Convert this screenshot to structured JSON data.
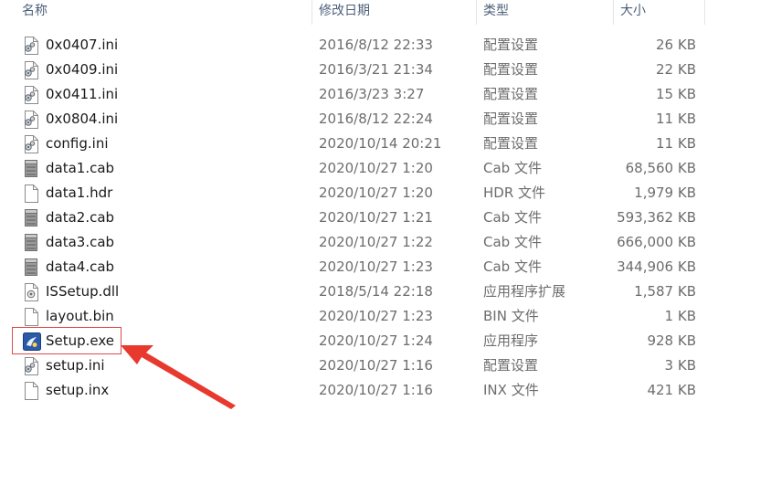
{
  "columns": {
    "name": "名称",
    "date": "修改日期",
    "type": "类型",
    "size": "大小"
  },
  "files": [
    {
      "name": "0x0407.ini",
      "date": "2016/8/12 22:33",
      "type": "配置设置",
      "size": "26 KB",
      "icon": "ini-settings-icon"
    },
    {
      "name": "0x0409.ini",
      "date": "2016/3/21 21:34",
      "type": "配置设置",
      "size": "22 KB",
      "icon": "ini-settings-icon"
    },
    {
      "name": "0x0411.ini",
      "date": "2016/3/23 3:27",
      "type": "配置设置",
      "size": "15 KB",
      "icon": "ini-settings-icon"
    },
    {
      "name": "0x0804.ini",
      "date": "2016/8/12 22:24",
      "type": "配置设置",
      "size": "11 KB",
      "icon": "ini-settings-icon"
    },
    {
      "name": "config.ini",
      "date": "2020/10/14 20:21",
      "type": "配置设置",
      "size": "11 KB",
      "icon": "ini-settings-icon"
    },
    {
      "name": "data1.cab",
      "date": "2020/10/27 1:20",
      "type": "Cab 文件",
      "size": "68,560 KB",
      "icon": "cab-archive-icon"
    },
    {
      "name": "data1.hdr",
      "date": "2020/10/27 1:20",
      "type": "HDR 文件",
      "size": "1,979 KB",
      "icon": "blank-file-icon"
    },
    {
      "name": "data2.cab",
      "date": "2020/10/27 1:21",
      "type": "Cab 文件",
      "size": "593,362 KB",
      "icon": "cab-archive-icon"
    },
    {
      "name": "data3.cab",
      "date": "2020/10/27 1:22",
      "type": "Cab 文件",
      "size": "666,000 KB",
      "icon": "cab-archive-icon"
    },
    {
      "name": "data4.cab",
      "date": "2020/10/27 1:23",
      "type": "Cab 文件",
      "size": "344,906 KB",
      "icon": "cab-archive-icon"
    },
    {
      "name": "ISSetup.dll",
      "date": "2018/5/14 22:18",
      "type": "应用程序扩展",
      "size": "1,587 KB",
      "icon": "dll-gear-icon"
    },
    {
      "name": "layout.bin",
      "date": "2020/10/27 1:23",
      "type": "BIN 文件",
      "size": "1 KB",
      "icon": "blank-file-icon"
    },
    {
      "name": "Setup.exe",
      "date": "2020/10/27 1:24",
      "type": "应用程序",
      "size": "928 KB",
      "icon": "setup-exe-icon"
    },
    {
      "name": "setup.ini",
      "date": "2020/10/27 1:16",
      "type": "配置设置",
      "size": "3 KB",
      "icon": "ini-settings-icon"
    },
    {
      "name": "setup.inx",
      "date": "2020/10/27 1:16",
      "type": "INX 文件",
      "size": "421 KB",
      "icon": "blank-file-icon"
    }
  ],
  "highlight": {
    "file": "Setup.exe",
    "box_color": "#e04a4a",
    "arrow_color": "#e8392f"
  },
  "colors": {
    "header_text": "#4c607a",
    "detail_text": "#6d6d6d",
    "name_text": "#1a1a1a"
  }
}
